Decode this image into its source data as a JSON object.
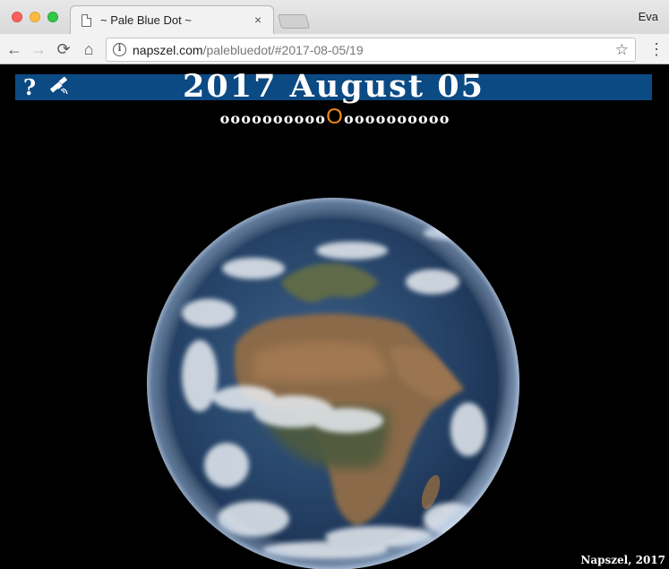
{
  "browser": {
    "tab_title": "~ Pale Blue Dot ~",
    "tab_close": "×",
    "profile_name": "Eva",
    "url_host": "napszel.com",
    "url_path": "/palebluedot/#2017-08-05/19",
    "nav": {
      "back": "←",
      "forward": "→",
      "reload": "⟳",
      "home": "⌂"
    },
    "star": "☆",
    "menu": "⋮",
    "info": "i"
  },
  "page": {
    "help_label": "?",
    "date_title": "2017 August 05",
    "frames": {
      "glyph": "o",
      "active_glyph": "O",
      "count": 20,
      "active_index": 10
    },
    "credit": "Napszel, 2017",
    "colors": {
      "banner": "#0c4a84",
      "active_frame": "#f28c1a",
      "background": "#000000"
    },
    "icons": [
      "help-icon",
      "satellite-icon"
    ]
  }
}
